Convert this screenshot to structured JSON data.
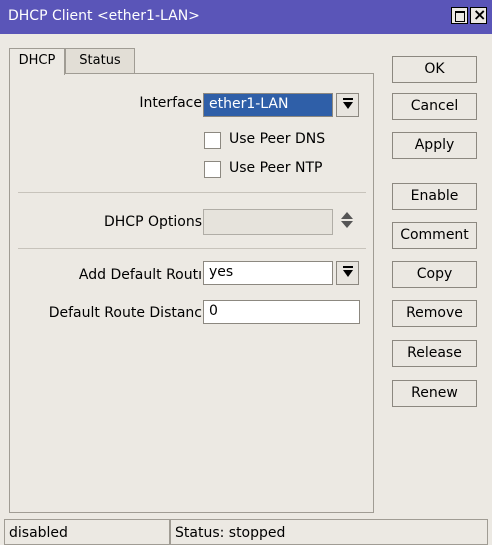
{
  "window": {
    "title": "DHCP Client <ether1-LAN>"
  },
  "tabs": [
    {
      "label": "DHCP"
    },
    {
      "label": "Status"
    }
  ],
  "form": {
    "interface_label": "Interface",
    "interface_value": "ether1-LAN",
    "use_peer_dns_label": "Use Peer DNS",
    "use_peer_dns_checked": false,
    "use_peer_ntp_label": "Use Peer NTP",
    "use_peer_ntp_checked": false,
    "dhcp_options_label": "DHCP Options",
    "dhcp_options_value": "",
    "add_default_route_label": "Add Default Routı",
    "add_default_route_value": "yes",
    "default_route_distance_label": "Default Route Distanc",
    "default_route_distance_value": "0"
  },
  "buttons": {
    "ok": "OK",
    "cancel": "Cancel",
    "apply": "Apply",
    "enable": "Enable",
    "comment": "Comment",
    "copy": "Copy",
    "remove": "Remove",
    "release": "Release",
    "renew": "Renew"
  },
  "statusbar": {
    "state": "disabled",
    "status": "Status: stopped"
  },
  "colors": {
    "titlebar": "#5a55b8",
    "selection": "#2f5fa8",
    "background": "#ece9e3"
  }
}
